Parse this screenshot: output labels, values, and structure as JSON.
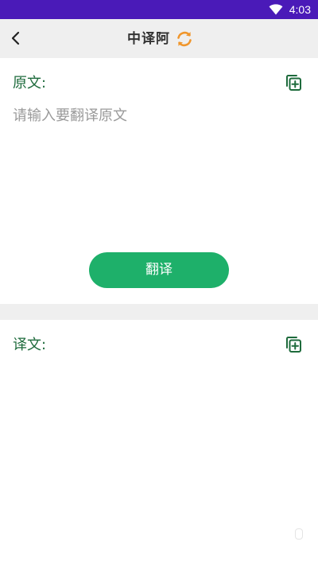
{
  "status_bar": {
    "time": "4:03",
    "wifi_icon": "wifi-icon",
    "background": "#4a1ab8"
  },
  "header": {
    "back_icon": "chevron-left-icon",
    "title": "中译阿",
    "swap_icon": "refresh-swap-icon",
    "swap_color": "#f0962c"
  },
  "source": {
    "label": "原文:",
    "placeholder": "请输入要翻译原文",
    "value": "",
    "copy_icon": "copy-add-icon"
  },
  "translate_button": {
    "label": "翻译",
    "color": "#1eb06a"
  },
  "result": {
    "label": "译文:",
    "text": "",
    "copy_icon": "copy-add-icon"
  },
  "colors": {
    "label_green": "#1e6b3c",
    "placeholder_gray": "#9a9a9a",
    "header_bg": "#efefef"
  }
}
